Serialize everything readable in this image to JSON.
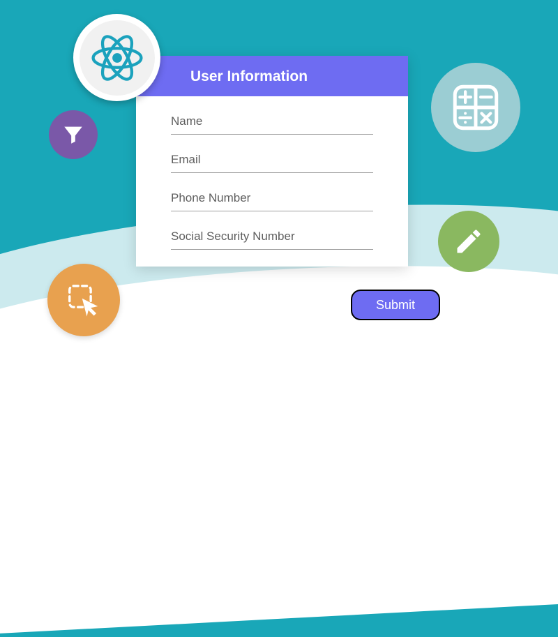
{
  "form": {
    "title": "User Information",
    "fields": {
      "name": {
        "placeholder": "Name",
        "value": ""
      },
      "email": {
        "placeholder": "Email",
        "value": ""
      },
      "phone": {
        "placeholder": "Phone Number",
        "value": ""
      },
      "ssn": {
        "placeholder": "Social Security Number",
        "value": ""
      }
    },
    "submit_label": "Submit"
  },
  "colors": {
    "accent": "#6e6cf2",
    "bg": "#19a7b8"
  }
}
